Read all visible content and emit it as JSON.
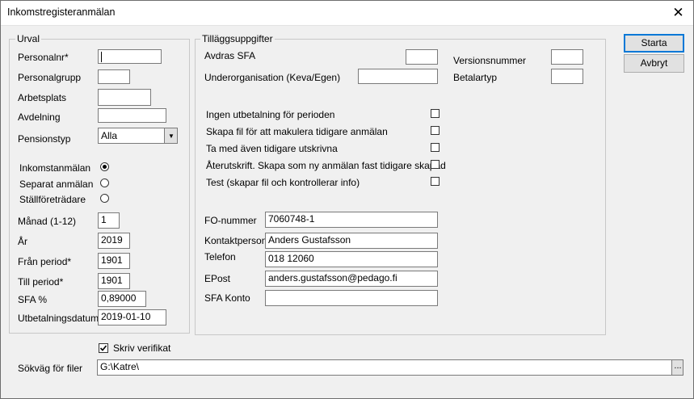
{
  "window": {
    "title": "Inkomstregisteranmälan",
    "close_glyph": "✕"
  },
  "buttons": {
    "start": "Starta",
    "cancel": "Avbryt"
  },
  "urval": {
    "legend": "Urval",
    "personalnr_label": "Personalnr*",
    "personalnr_value": "",
    "personalgrupp_label": "Personalgrupp",
    "personalgrupp_value": "",
    "arbetsplats_label": "Arbetsplats",
    "arbetsplats_value": "",
    "avdelning_label": "Avdelning",
    "avdelning_value": "",
    "pensionstyp_label": "Pensionstyp",
    "pensionstyp_value": "Alla",
    "radio_inkomst": "Inkomstanmälan",
    "radio_separat": "Separat anmälan",
    "radio_stallforetradare": "Ställföreträdare",
    "selected_radio": "Inkomstanmälan",
    "manad_label": "Månad (1-12)",
    "manad_value": "1",
    "ar_label": "År",
    "ar_value": "2019",
    "fran_label": "Från period*",
    "fran_value": "1901",
    "till_label": "Till period*",
    "till_value": "1901",
    "sfa_label": "SFA %",
    "sfa_value": "0,89000",
    "utbet_label": "Utbetalningsdatum",
    "utbet_value": "2019-01-10"
  },
  "tillagg": {
    "legend": "Tilläggsuppgifter",
    "avdras_sfa_label": "Avdras SFA",
    "avdras_sfa_value": "",
    "versionsnummer_label": "Versionsnummer",
    "versionsnummer_value": "",
    "underorg_label": "Underorganisation (Keva/Egen)",
    "underorg_value": "",
    "betalartyp_label": "Betalartyp",
    "betalartyp_value": "",
    "cb_ingen": "Ingen utbetalning för perioden",
    "cb_makulera": "Skapa fil för att makulera tidigare anmälan",
    "cb_tidigare": "Ta med även tidigare utskrivna",
    "cb_aterutskrift": "Återutskrift. Skapa som ny anmälan fast tidigare skapad",
    "cb_test": "Test (skapar fil och kontrollerar info)",
    "fo_label": "FO-nummer",
    "fo_value": "7060748-1",
    "kontakt_label": "Kontaktperson",
    "kontakt_value": "Anders Gustafsson",
    "telefon_label": "Telefon",
    "telefon_value": "018 12060",
    "epost_label": "EPost",
    "epost_value": "anders.gustafsson@pedago.fi",
    "sfakonto_label": "SFA Konto",
    "sfakonto_value": ""
  },
  "bottom": {
    "skriv_verifikat_label": "Skriv verifikat",
    "skriv_verifikat_checked": true,
    "sokvag_label": "Sökväg för filer",
    "sokvag_value": "G:\\Katre\\",
    "browse_glyph": "..."
  }
}
